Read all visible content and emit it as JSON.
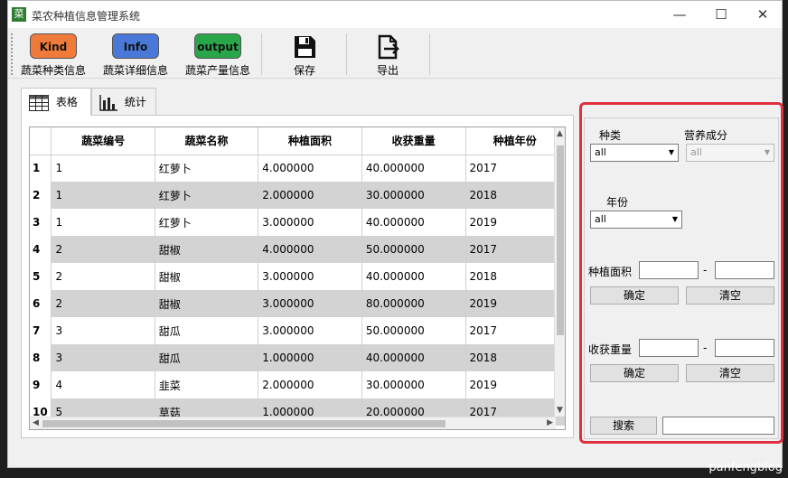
{
  "window": {
    "title": "菜农种植信息管理系统",
    "app_icon": "菜",
    "minimize": "—",
    "maximize": "☐",
    "close": "✕"
  },
  "toolbar": {
    "items": [
      {
        "badge": "Kind",
        "label": "蔬菜种类信息",
        "color": "#f07a3a"
      },
      {
        "badge": "Info",
        "label": "蔬菜详细信息",
        "color": "#4a78d8"
      },
      {
        "badge": "output",
        "label": "蔬菜产量信息",
        "color": "#2aa64a"
      },
      {
        "label": "保存",
        "icon": "save-icon"
      },
      {
        "label": "导出",
        "icon": "export-icon"
      }
    ]
  },
  "tabs": [
    {
      "label": "表格",
      "icon": "table-icon"
    },
    {
      "label": "统计",
      "icon": "bar-chart-icon"
    }
  ],
  "table": {
    "columns": [
      "蔬菜编号",
      "蔬菜名称",
      "种植面积",
      "收获重量",
      "种植年份"
    ],
    "rows": [
      {
        "n": "1",
        "cells": [
          "1",
          "红萝卜",
          "4.000000",
          "40.000000",
          "2017"
        ]
      },
      {
        "n": "2",
        "cells": [
          "1",
          "红萝卜",
          "2.000000",
          "30.000000",
          "2018"
        ]
      },
      {
        "n": "3",
        "cells": [
          "1",
          "红萝卜",
          "3.000000",
          "40.000000",
          "2019"
        ]
      },
      {
        "n": "4",
        "cells": [
          "2",
          "甜椒",
          "4.000000",
          "50.000000",
          "2017"
        ]
      },
      {
        "n": "5",
        "cells": [
          "2",
          "甜椒",
          "3.000000",
          "40.000000",
          "2018"
        ]
      },
      {
        "n": "6",
        "cells": [
          "2",
          "甜椒",
          "3.000000",
          "80.000000",
          "2019"
        ]
      },
      {
        "n": "7",
        "cells": [
          "3",
          "甜瓜",
          "3.000000",
          "50.000000",
          "2017"
        ]
      },
      {
        "n": "8",
        "cells": [
          "3",
          "甜瓜",
          "1.000000",
          "40.000000",
          "2018"
        ]
      },
      {
        "n": "9",
        "cells": [
          "4",
          "韭菜",
          "2.000000",
          "30.000000",
          "2019"
        ]
      },
      {
        "n": "10",
        "cells": [
          "5",
          "草菇",
          "1.000000",
          "20.000000",
          "2017"
        ]
      }
    ]
  },
  "filter": {
    "kind_label": "种类",
    "kind_value": "all",
    "nutrition_label": "营养成分",
    "nutrition_value": "all",
    "year_label": "年份",
    "year_value": "all",
    "area_label": "种植面积",
    "range_sep": "-",
    "confirm_label": "确定",
    "clear_label": "清空",
    "weight_label": "收获重量",
    "search_label": "搜索"
  },
  "watermark": "panfengblog"
}
